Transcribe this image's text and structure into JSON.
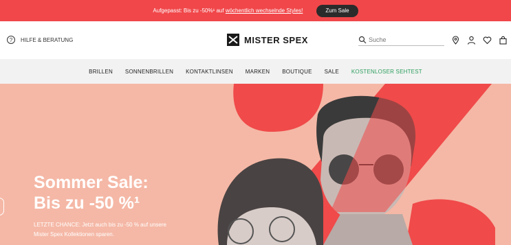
{
  "promo": {
    "text_before": "Aufgepasst: Bis zu -50%¹ auf ",
    "link": "wöchentlich wechselnde Styles!",
    "button": "Zum Sale"
  },
  "header": {
    "help_label": "HILFE & BERATUNG",
    "brand": "MISTER SPEX",
    "search_placeholder": "Suche"
  },
  "nav": {
    "items": [
      "BRILLEN",
      "SONNENBRILLEN",
      "KONTAKTLINSEN",
      "MARKEN",
      "BOUTIQUE",
      "SALE",
      "KOSTENLOSER SEHTEST"
    ]
  },
  "hero": {
    "headline_line1": "Sommer Sale:",
    "headline_line2": "Bis zu -50 %¹",
    "subtext": "LETZTE CHANCE: Jetzt auch bis zu -50 % auf unsere Mister Spex Kollektionen sparen."
  },
  "colors": {
    "promo_bg": "#f1474a",
    "hero_bg": "#f5b8a6",
    "accent_red": "#f04a4a",
    "green_link": "#2a9d5b"
  }
}
